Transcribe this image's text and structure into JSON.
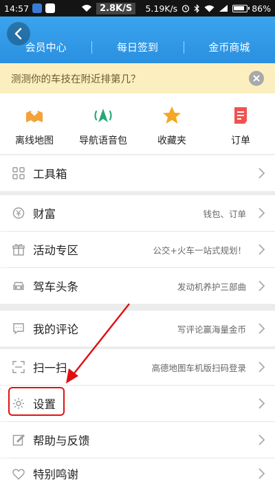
{
  "status_bar": {
    "time": "14:57",
    "speed": "2.8K/S",
    "speed2": "5.19K/s",
    "battery": "86%",
    "battery_level": 0.86
  },
  "header": {
    "tabs": [
      "会员中心",
      "每日签到",
      "金币商城"
    ],
    "colors": {
      "primary": "#3aa4ee"
    }
  },
  "notice": {
    "text": "测测你的车技在附近排第几？"
  },
  "quick_actions": [
    {
      "label": "离线地图",
      "icon": "offline-map-icon",
      "color": "#f2a23b"
    },
    {
      "label": "导航语音包",
      "icon": "voice-pack-icon",
      "color": "#27a874"
    },
    {
      "label": "收藏夹",
      "icon": "star-icon",
      "color": "#f5a623"
    },
    {
      "label": "订单",
      "icon": "order-icon",
      "color": "#ef5350"
    }
  ],
  "menu": {
    "toolbox": {
      "label": "工具箱",
      "icon": "grid-icon"
    },
    "wealth": {
      "label": "财富",
      "value": "钱包、订单",
      "icon": "coin-icon"
    },
    "events": {
      "label": "活动专区",
      "value": "公交+火车一站式规划！",
      "icon": "gift-icon"
    },
    "driving_news": {
      "label": "驾车头条",
      "value": "发动机养护三部曲",
      "icon": "car-icon"
    },
    "my_reviews": {
      "label": "我的评论",
      "value": "写评论赢海量金币",
      "icon": "comment-icon"
    },
    "scan": {
      "label": "扫一扫",
      "value": "高德地图车机版扫码登录",
      "icon": "scan-icon"
    },
    "settings": {
      "label": "设置",
      "icon": "gear-icon"
    },
    "help": {
      "label": "帮助与反馈",
      "icon": "edit-icon"
    },
    "thanks": {
      "label": "特别鸣谢",
      "icon": "heart-icon"
    }
  }
}
